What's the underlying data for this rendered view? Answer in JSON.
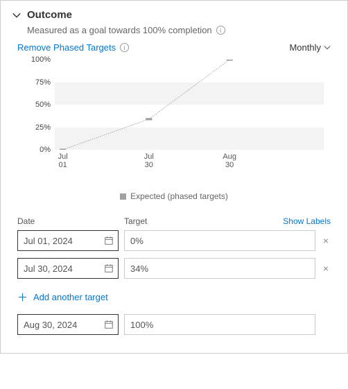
{
  "header": {
    "title": "Outcome",
    "subtitle": "Measured as a goal towards 100% completion",
    "remove_link": "Remove Phased Targets",
    "period_label": "Monthly"
  },
  "grid": {
    "date_header": "Date",
    "target_header": "Target",
    "show_labels": "Show Labels",
    "add_link": "Add another target",
    "rows": [
      {
        "date": "Jul 01, 2024",
        "target_display": "0%",
        "removable": true
      },
      {
        "date": "Jul 30, 2024",
        "target_display": "34%",
        "removable": true
      }
    ],
    "final": {
      "date": "Aug 30, 2024",
      "target_display": "100%",
      "removable": false
    }
  },
  "chart_data": {
    "type": "line",
    "title": "",
    "xlabel": "",
    "ylabel": "",
    "ylim": [
      0,
      100
    ],
    "y_ticks": [
      0,
      25,
      50,
      75,
      100
    ],
    "y_tick_labels": [
      "0%",
      "25%",
      "50%",
      "75%",
      "100%"
    ],
    "x_tick_labels": [
      "Jul\n01",
      "Jul\n30",
      "Aug\n30"
    ],
    "legend": [
      "Expected (phased targets)"
    ],
    "series": [
      {
        "name": "Expected (phased targets)",
        "x": [
          "2024-07-01",
          "2024-07-30",
          "2024-08-30"
        ],
        "y": [
          0,
          34,
          100
        ],
        "x_norm": [
          0.03,
          0.35,
          0.65
        ]
      }
    ]
  },
  "colors": {
    "link": "#0078d4",
    "series": "#a0a0a0",
    "band": "#f3f3f3"
  }
}
